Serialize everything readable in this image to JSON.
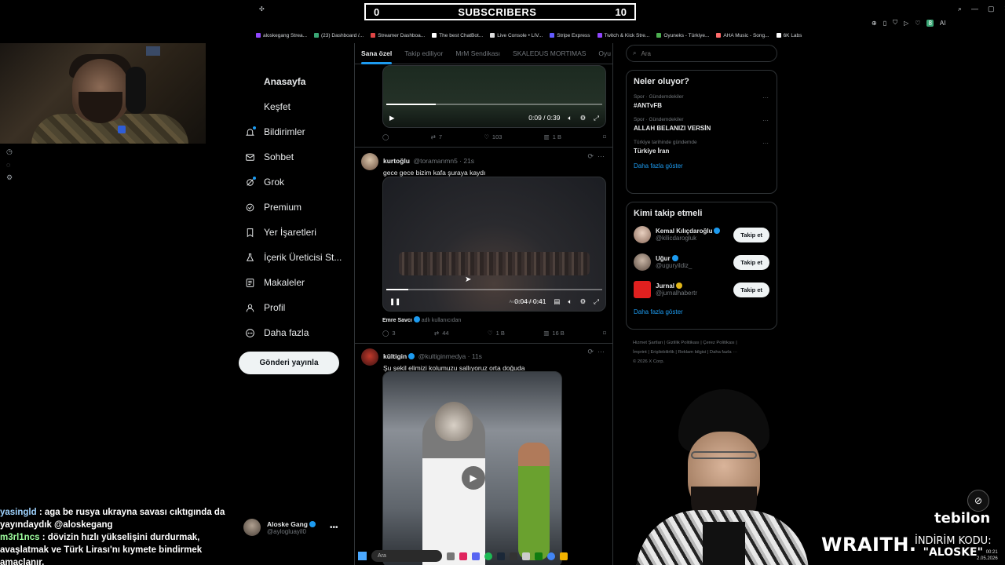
{
  "subscribers": {
    "left": "0",
    "label": "SUBSCRIBERS",
    "right": "10"
  },
  "bookmarks": [
    {
      "label": "aloskegang Strea...",
      "color": "#9147ff"
    },
    {
      "label": "(23) Dashboard /...",
      "color": "#3aa675"
    },
    {
      "label": "Streamer Dashboa...",
      "color": "#e04545"
    },
    {
      "label": "The best ChatBot...",
      "color": "#ffffff"
    },
    {
      "label": "Live Console • LIV...",
      "color": "#dddddd"
    },
    {
      "label": "Stripe Express",
      "color": "#635bff"
    },
    {
      "label": "Twitch & Kick Stre...",
      "color": "#9147ff"
    },
    {
      "label": "Oyuneks - Türkiye...",
      "color": "#4caf50"
    },
    {
      "label": "AHA Music - Song...",
      "color": "#ff6b6b"
    },
    {
      "label": "6K Labs",
      "color": "#ffffff"
    }
  ],
  "toolbar": {
    "ai_label": "AI"
  },
  "nav": [
    {
      "icon": "home-icon",
      "label": "Anasayfa",
      "bold": true
    },
    {
      "icon": "search-icon",
      "label": "Keşfet"
    },
    {
      "icon": "bell-icon",
      "label": "Bildirimler",
      "badge": true
    },
    {
      "icon": "mail-icon",
      "label": "Sohbet"
    },
    {
      "icon": "grok-icon",
      "label": "Grok",
      "badge": true
    },
    {
      "icon": "premium-icon",
      "label": "Premium"
    },
    {
      "icon": "bookmark-icon",
      "label": "Yer İşaretleri"
    },
    {
      "icon": "flask-icon",
      "label": "İçerik Üreticisi St..."
    },
    {
      "icon": "article-icon",
      "label": "Makaleler"
    },
    {
      "icon": "profile-icon",
      "label": "Profil"
    },
    {
      "icon": "more-icon",
      "label": "Daha fazla"
    }
  ],
  "post_button": "Gönderi yayınla",
  "account": {
    "name": "Aloske Gang",
    "handle": "@aylogluayil0",
    "more": "•••"
  },
  "tabs": [
    "Sana özel",
    "Takip ediliyor",
    "MrM Sendikası",
    "SKALEDUS MORTIMAS",
    "Oyu"
  ],
  "tweets": {
    "t0": {
      "time": "0:09 / 0:39",
      "progress": 0.23,
      "retweets": "7",
      "likes": "103",
      "views": "1 B"
    },
    "t1": {
      "name": "kurtoğlu",
      "handle": "@toramanmn5 · 21s",
      "text": "gece gece bizim kafa şuraya kaydı",
      "time": "0:04 / 0:41",
      "progress": 0.1,
      "watermark": "Aoyumculamumu",
      "mention_name": "Emre Savcı",
      "mention_suffix": "adlı kullanıcıdan",
      "replies": "3",
      "retweets": "44",
      "likes": "1 B",
      "views": "16 B"
    },
    "t2": {
      "name": "kültigin",
      "handle": "@kultiginmedya · 11s",
      "text": "Şu şekil elimizi kolumuzu sallıyoruz orta doğuda"
    }
  },
  "search": {
    "placeholder": "Ara"
  },
  "trends": {
    "title": "Neler oluyor?",
    "items": [
      {
        "context": "Spor · Gündemdekiler",
        "topic": "#ANTvFB"
      },
      {
        "context": "Spor · Gündemdekiler",
        "topic": "ALLAH BELANIZI VERSİN"
      },
      {
        "context": "Türkiye tarihinde gündemde",
        "topic": "Türkiye İran"
      }
    ],
    "show_more": "Daha fazla göster"
  },
  "who_to_follow": {
    "title": "Kimi takip etmeli",
    "items": [
      {
        "name": "Kemal Kılıçdaroğlu",
        "handle": "@kilicdarogluk",
        "button": "Takip et",
        "badge": "blue"
      },
      {
        "name": "Uğur",
        "handle": "@uguryildiz_",
        "button": "Takip et",
        "badge": "blue"
      },
      {
        "name": "Jurnal",
        "handle": "@jurnalhabertr",
        "button": "Takip et",
        "badge": "gold"
      }
    ],
    "show_more": "Daha fazla göster"
  },
  "footer": {
    "line1": "Hizmet Şartları  |  Gizlilik Politikası  |  Çerez Politikası  |",
    "line2": "İmprint  |  Erişilebilirlik  |  Reklam bilgisi  |  Daha fazla ···",
    "line3": "© 2026 X Corp."
  },
  "chat": [
    {
      "user": "yasingld",
      "message": " : aga be rusya ukrayna savası cıktıgında da yayındaydık @aloskegang"
    },
    {
      "user": "m3rl1ncs",
      "message": " : dövizin hızlı yükselişini durdurmak,"
    },
    {
      "user": "",
      "message": "avaşlatmak ve Türk Lirası'nı kıymete bindirmek amaçlanır."
    }
  ],
  "overlay": {
    "brand": "WRAITH.",
    "promo_line1": "İNDİRİM KODU:",
    "promo_line2": "\"ALOSKE\"",
    "sponsor": "tebilon"
  },
  "taskbar": {
    "search": "Ara"
  },
  "clock": {
    "time": "00:21",
    "date": "2.05.2026"
  }
}
